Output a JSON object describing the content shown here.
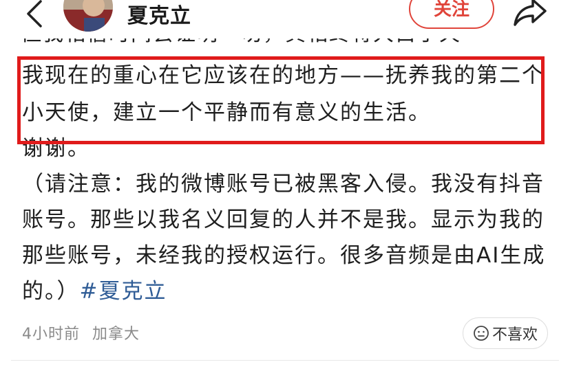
{
  "header": {
    "username": "夏克立",
    "follow_label": "关注"
  },
  "post": {
    "clipped_line": "但我相信时间会证明一切，真相终将大白于天下",
    "line1": "我现在的重心在它应该在的地方——抚养我的第二个",
    "line2": "小天使，建立一个平静而有意义的生活。",
    "line3": "谢谢。",
    "line4": "（请注意：我的微博账号已被黑客入侵。我没有抖音",
    "line5": "账号。那些以我名义回复的人并不是我。显示为我的",
    "line6": "那些账号，未经我的授权运行。很多音频是由AI生成",
    "line7_text": "的。）",
    "hashtag": "#夏克立"
  },
  "meta": {
    "time": "4小时前",
    "location": "加拿大",
    "dislike_label": "不喜欢"
  },
  "colors": {
    "accent_red": "#e0443a",
    "highlight_red": "#e01b1b",
    "hashtag_blue": "#2f5c96",
    "meta_gray": "#8a8a8a"
  }
}
